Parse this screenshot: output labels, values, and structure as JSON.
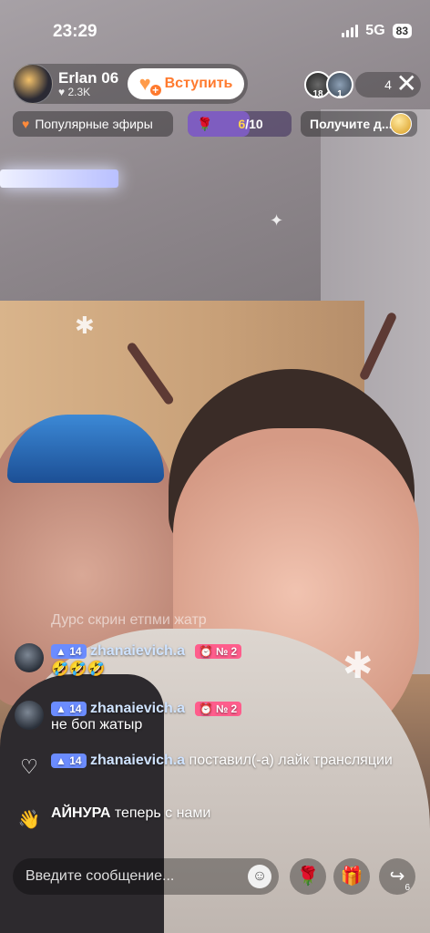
{
  "status": {
    "time": "23:29",
    "network": "5G",
    "battery": "83"
  },
  "host": {
    "name": "Erlan 06",
    "likes": "2.3K",
    "join_label": "Вступить"
  },
  "viewers": {
    "avatar_badges": [
      "18",
      "1"
    ],
    "count": "4"
  },
  "chips": {
    "popular": "Популярные эфиры",
    "goal_current": "6",
    "goal_total": "/10",
    "goal_fraction": 0.6,
    "get": "Получите д..."
  },
  "caption": "Дурс скрин етпми жатр",
  "comments": [
    {
      "level": "14",
      "user": "zhanaievich.a",
      "fan": "№ 2",
      "text": "🤣🤣🤣"
    },
    {
      "level": "14",
      "user": "zhanaievich.a",
      "fan": "№ 2",
      "text": "не боп жатыр"
    },
    {
      "level": "14",
      "user": "zhanaievich.a",
      "text": "поставил(-а) лайк трансляции"
    },
    {
      "user": "АЙНУРА",
      "text": "теперь с нами"
    }
  ],
  "input_placeholder": "Введите сообщение...",
  "share_count": "6",
  "colors": {
    "accent": "#ff7a2e",
    "level_badge": "#6b8cff",
    "fan_badge": "#ff5d8c"
  }
}
